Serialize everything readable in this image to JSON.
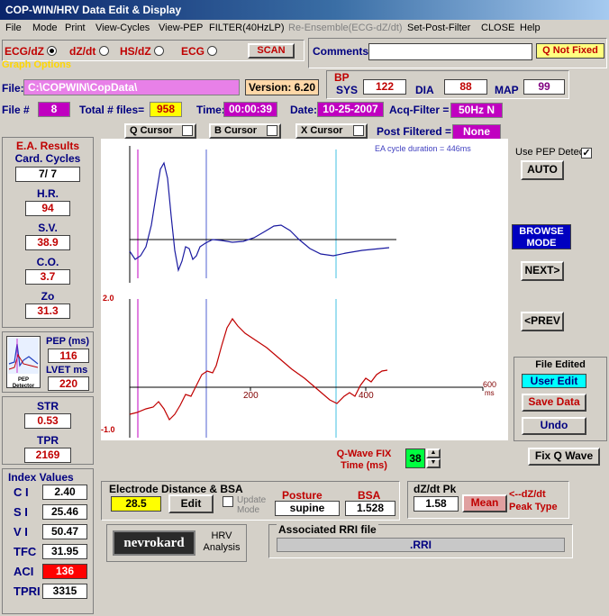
{
  "window_title": "COP-WIN/HRV  Data Edit & Display",
  "menu": [
    "File",
    "Mode",
    "Print",
    "View-Cycles",
    "View-PEP",
    "FILTER(40HzLP)",
    "Re-Ensemble(ECG-dZ/dt)",
    "Set-Post-Filter",
    "CLOSE",
    "Help"
  ],
  "graph_options": {
    "label": "Graph Options",
    "radios": [
      "ECG/dZ",
      "dZ/dt",
      "HS/dZ",
      "ECG"
    ],
    "scan_label": "SCAN"
  },
  "comments": {
    "label": "Comments:",
    "value": "",
    "q_status": "Q Not Fixed"
  },
  "file": {
    "path_label": "File:",
    "path": "C:\\COPWIN\\CopData\\",
    "version_label": "Version:",
    "version": "6.20",
    "num_label": "File #",
    "num": "8",
    "total_label": "Total # files=",
    "total": "958",
    "time_label": "Time:",
    "time": "00:00:39",
    "date_label": "Date:",
    "date": "10-25-2007",
    "acq_label": "Acq-Filter =",
    "acq": "50Hz N",
    "post_label": "Post Filtered =",
    "post": "None"
  },
  "bp": {
    "title": "BP",
    "sys_label": "SYS",
    "sys": "122",
    "dia_label": "DIA",
    "dia": "88",
    "map_label": "MAP",
    "map": "99"
  },
  "cursors": [
    "Q Cursor",
    "B Cursor",
    "X Cursor"
  ],
  "ea": {
    "title": "E.A. Results",
    "items": [
      {
        "label": "Card. Cycles",
        "value": "7/ 7",
        "color": "#000000"
      },
      {
        "label": "H.R.",
        "value": "94",
        "color": "#c00000"
      },
      {
        "label": "S.V.",
        "value": "38.9",
        "color": "#c00000"
      },
      {
        "label": "C.O.",
        "value": "3.7",
        "color": "#c00000"
      },
      {
        "label": "Zo",
        "value": "31.3",
        "color": "#c00000"
      }
    ]
  },
  "pep": {
    "pep_label": "PEP (ms)",
    "pep": "116",
    "lvet_label": "LVET ms",
    "lvet": "220",
    "icon_caption": "PEP Detector"
  },
  "str": {
    "str_label": "STR",
    "str": "0.53",
    "tpr_label": "TPR",
    "tpr": "2169"
  },
  "index_values": {
    "title": "Index Values",
    "items": [
      {
        "label": "C I",
        "value": "2.40",
        "alert": false
      },
      {
        "label": "S I",
        "value": "25.46",
        "alert": false
      },
      {
        "label": "V I",
        "value": "50.47",
        "alert": false
      },
      {
        "label": "TFC",
        "value": "31.95",
        "alert": false
      },
      {
        "label": "ACI",
        "value": "136",
        "alert": true
      },
      {
        "label": "TPRI",
        "value": "3315",
        "alert": false
      }
    ]
  },
  "graph": {
    "ea_text": "EA cycle duration = 446ms",
    "y_top": "2.0",
    "y_bottom": "-1.0",
    "x_ticks": [
      "200",
      "400",
      "600"
    ],
    "x_unit": "ms"
  },
  "right": {
    "pep_detect_label": "Use PEP Detect",
    "auto": "AUTO",
    "browse": "BROWSE MODE",
    "next": "NEXT>",
    "prev": "<PREV",
    "file_edited_title": "File Edited",
    "user_edit": "User Edit",
    "save": "Save Data",
    "undo": "Undo",
    "fix_q": "Fix Q Wave"
  },
  "qwave": {
    "label": "Q-Wave FIX Time (ms)",
    "value": "38"
  },
  "electrode": {
    "title": "Electrode Distance & BSA",
    "distance": "28.5",
    "edit": "Edit",
    "update": "Update Mode",
    "posture_label": "Posture",
    "posture": "supine",
    "bsa_label": "BSA",
    "bsa": "1.528"
  },
  "dzdt": {
    "title": "dZ/dt Pk",
    "value": "1.58",
    "mean": "Mean",
    "type_label": "<--dZ/dt Peak Type"
  },
  "nevrokard": {
    "logo": "nevrokard",
    "hrv": "HRV Analysis"
  },
  "rri": {
    "title": "Associated RRI file",
    "value": ".RRI"
  }
}
